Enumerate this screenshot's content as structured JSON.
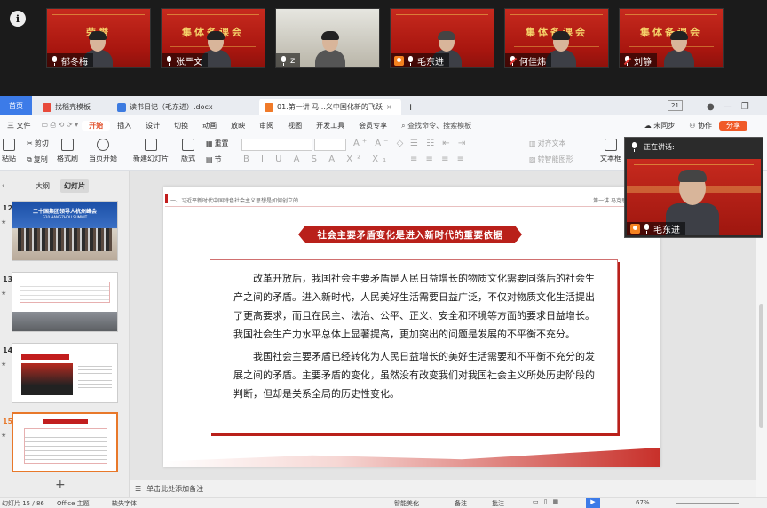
{
  "meeting": {
    "info_label": "i",
    "participants": [
      {
        "name": "郁冬梅",
        "mic": "on",
        "title": "荣誉"
      },
      {
        "name": "张严文",
        "mic": "on",
        "title": "集体备课会"
      },
      {
        "name": "z",
        "mic": "on",
        "title": ""
      },
      {
        "name": "毛东进",
        "mic": "on",
        "title": ""
      },
      {
        "name": "何佳炜",
        "mic": "off",
        "title": "集体备课会"
      },
      {
        "name": "刘静",
        "mic": "off",
        "title": "集体备课会"
      }
    ]
  },
  "tabs": {
    "home": "首页",
    "items": [
      {
        "label": "找稻壳模板",
        "color": "#e84a3b"
      },
      {
        "label": "读书日记（毛东进）.docx",
        "color": "#3d7be0"
      },
      {
        "label": "01.第一讲 马...义中国化新的飞跃",
        "color": "#f07a29"
      }
    ],
    "add": "+",
    "window_number": "21"
  },
  "ribbon": {
    "menu": [
      "三 文件",
      "开始",
      "插入",
      "设计",
      "切换",
      "动画",
      "放映",
      "审阅",
      "视图",
      "开发工具",
      "会员专享"
    ],
    "active": "开始",
    "search": "查找命令、搜索模板",
    "sync": "未同步",
    "collab": "协作",
    "share": "分享",
    "tools": {
      "paste": "粘贴",
      "cut": "剪切",
      "copy": "复制",
      "format_painter": "格式刷",
      "from_current": "当页开始",
      "new_slide": "新建幻灯片",
      "layout": "版式",
      "section": "节",
      "reset": "重置",
      "text_box": "文本框",
      "align_text": "对齐文本",
      "to_smartart": "转智能图形"
    }
  },
  "left_panel": {
    "tab_outline": "大纲",
    "tab_slides": "幻灯片",
    "slides": [
      {
        "num": "12",
        "caption": "二十国集团领导人杭州峰会",
        "caption2": "G20 HANGZHOU SUMMIT"
      },
      {
        "num": "13",
        "caption": ""
      },
      {
        "num": "14",
        "caption": ""
      },
      {
        "num": "15",
        "caption": ""
      }
    ],
    "add_label": "+"
  },
  "slide": {
    "header_left": "一、习近平新时代中国特色社会主义思想是如何创立的",
    "header_right": "第一讲 马克思主义中国化",
    "banner": "社会主要矛盾变化是进入新时代的重要依据",
    "paragraphs": [
      "改革开放后，我国社会主要矛盾是人民日益增长的物质文化需要同落后的社会生产之间的矛盾。进入新时代，人民美好生活需要日益广泛，不仅对物质文化生活提出了更高要求，而且在民主、法治、公平、正义、安全和环境等方面的要求日益增长。我国社会生产力水平总体上显著提高，更加突出的问题是发展的不平衡不充分。",
      "我国社会主要矛盾已经转化为人民日益增长的美好生活需要和不平衡不充分的发展之间的矛盾。主要矛盾的变化，虽然没有改变我们对我国社会主义所处历史阶段的判断，但却是关系全局的历史性变化。"
    ]
  },
  "notes": {
    "placeholder": "单击此处添加备注"
  },
  "status": {
    "slide_pos": "幻灯片 15 / 86",
    "theme": "Office 主题",
    "font_missing": "缺失字体",
    "smart_beautify": "智能美化",
    "notes": "备注",
    "comments": "批注",
    "zoom": "67%"
  },
  "speaker": {
    "label": "正在讲话:",
    "name": "毛东进"
  }
}
